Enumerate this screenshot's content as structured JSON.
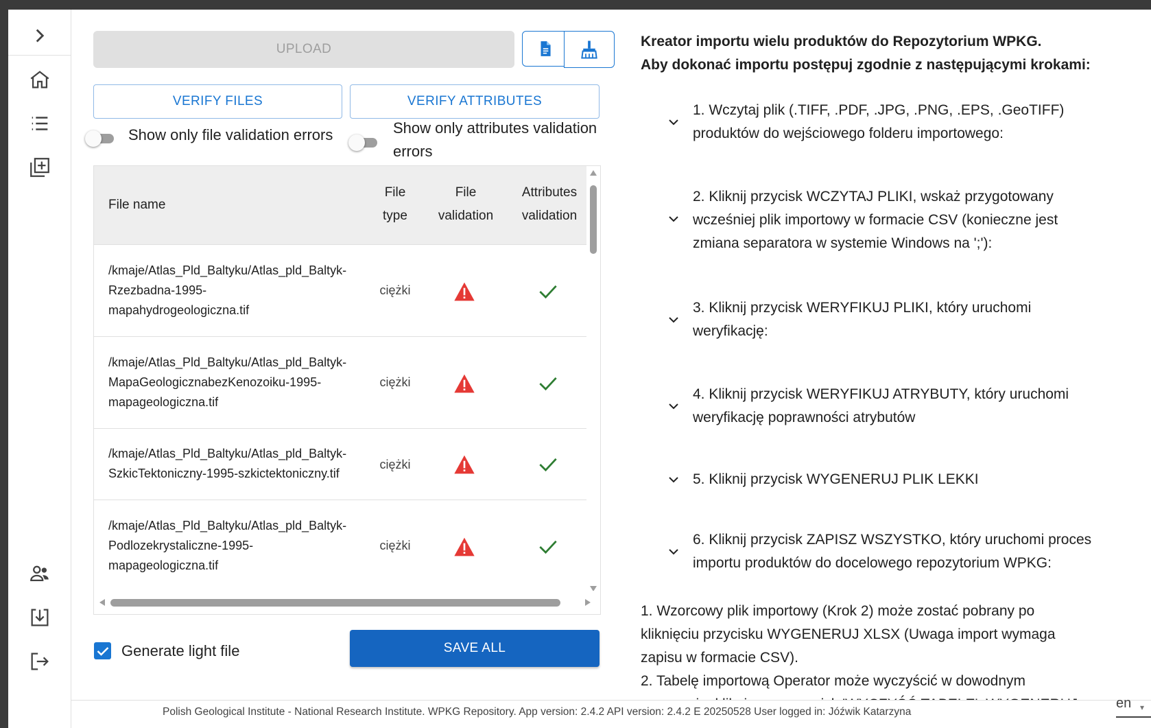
{
  "toolbar": {
    "upload_label": "UPLOAD",
    "verify_files_label": "VERIFY FILES",
    "verify_attributes_label": "VERIFY ATTRIBUTES",
    "doc_icon": "file-document-icon",
    "broom_icon": "broom-icon"
  },
  "toggles": {
    "file_errors_label": "Show only file validation errors",
    "attr_errors_label_1": "Show only attributes validation",
    "attr_errors_label_2": "errors"
  },
  "table": {
    "headers": {
      "file_name": "File name",
      "file_type_1": "File",
      "file_type_2": "type",
      "file_validation_1": "File",
      "file_validation_2": "validation",
      "attr_validation_1": "Attributes",
      "attr_validation_2": "validation"
    },
    "rows": [
      {
        "name_1": "/kmaje/Atlas_Pld_Baltyku/Atlas_pld_Baltyk-",
        "name_2": "Rzezbadna-1995-",
        "name_3": "mapahydrogeologiczna.tif",
        "type": "ciężki",
        "file_status": "warning",
        "attr_status": "ok"
      },
      {
        "name_1": "/kmaje/Atlas_Pld_Baltyku/Atlas_pld_Baltyk-",
        "name_2": "MapaGeologicznabezKenozoiku-1995-",
        "name_3": "mapageologiczna.tif",
        "type": "ciężki",
        "file_status": "warning",
        "attr_status": "ok"
      },
      {
        "name_1": "/kmaje/Atlas_Pld_Baltyku/Atlas_pld_Baltyk-",
        "name_2": "SzkicTektoniczny-1995-szkictektoniczny.tif",
        "type": "ciężki",
        "file_status": "warning",
        "attr_status": "ok"
      },
      {
        "name_1": "/kmaje/Atlas_Pld_Baltyku/Atlas_pld_Baltyk-",
        "name_2": "Podlozekrystaliczne-1995-",
        "name_3": "mapageologiczna.tif",
        "type": "ciężki",
        "file_status": "warning",
        "attr_status": "ok"
      }
    ]
  },
  "generate_light": {
    "label": "Generate light file",
    "checked": true
  },
  "save_all_label": "SAVE ALL",
  "instructions": {
    "title_1": "Kreator importu wielu produktów do Repozytorium WPKG.",
    "title_2": "Aby dokonać importu postępuj zgodnie z następującymi krokami:",
    "steps": [
      {
        "line_1": "1. Wczytaj plik (.TIFF, .PDF, .JPG, .PNG, .EPS, .GeoTIFF)",
        "line_2": "produktów do wejściowego folderu importowego:"
      },
      {
        "line_1": "2. Kliknij przycisk WCZYTAJ PLIKI, wskaż przygotowany",
        "line_2": "wcześniej plik importowy w formacie CSV (konieczne jest",
        "line_3": "zmiana separatora w systemie Windows na ';'):"
      },
      {
        "line_1": "3. Kliknij przycisk WERYFIKUJ PLIKI, który uruchomi",
        "line_2": "weryfikację:"
      },
      {
        "line_1": "4. Kliknij przycisk WERYFIKUJ ATRYBUTY, który uruchomi",
        "line_2": "weryfikację poprawności atrybutów"
      },
      {
        "line_1": "5. Kliknij przycisk WYGENERUJ PLIK LEKKI"
      },
      {
        "line_1": "6. Kliknij przycisk ZAPISZ WSZYSTKO, który uruchomi proces",
        "line_2": "importu produktów do docelowego repozytorium WPKG:"
      }
    ],
    "notes": [
      "1. Wzorcowy plik importowy (Krok 2) może zostać pobrany po",
      "kliknięciu przycisku WYGENERUJ XLSX (Uwaga import wymaga",
      "zapisu w formacie CSV).",
      "2. Tabelę importową Operator może wyczyścić w dowodnym",
      "momencie, klikając na przycisk 'WYCZYŚĆ TABELE'. WYGENERUJ"
    ]
  },
  "footer": {
    "text": "Polish Geological Institute - National Research Institute. WPKG Repository. App version: 2.4.2 API version: 2.4.2 E 20250528 User logged in: Jóźwik Katarzyna",
    "language": "en"
  },
  "colors": {
    "primary": "#1976d2",
    "warning": "#e53935",
    "success": "#2e7d32"
  }
}
